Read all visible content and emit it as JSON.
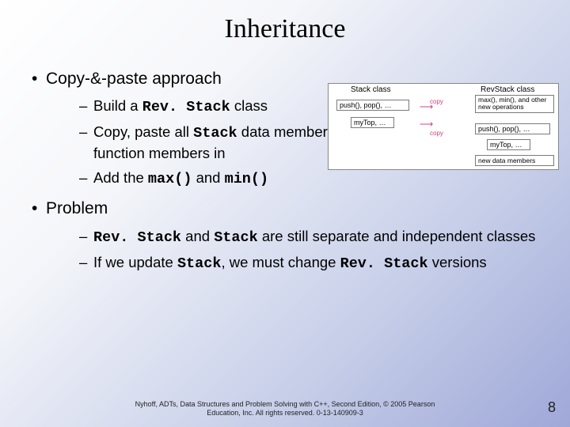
{
  "title": "Inheritance",
  "bullets": {
    "b1": "Copy-&-paste approach",
    "b1_1_a": "Build a ",
    "b1_1_code": "Rev. Stack",
    "b1_1_b": " class",
    "b1_2_a": "Copy, paste all ",
    "b1_2_code": "Stack",
    "b1_2_b": " data members and function members in",
    "b1_3_a": "Add the ",
    "b1_3_code1": "max()",
    "b1_3_mid": " and ",
    "b1_3_code2": "min()",
    "b2": "Problem",
    "b2_1_code1": "Rev. Stack",
    "b2_1_mid": " and ",
    "b2_1_code2": "Stack",
    "b2_1_b": " are still separate and independent classes",
    "b2_2_a": "If we update ",
    "b2_2_code1": "Stack",
    "b2_2_mid": ", we must change ",
    "b2_2_code2": "Rev. Stack",
    "b2_2_b": " versions"
  },
  "diagram": {
    "left_header": "Stack class",
    "right_header": "RevStack class",
    "left_box1": "push(), pop(), …",
    "left_box2": "myTop, …",
    "right_box1": "max(), min(), and other new operations",
    "right_box2": "push(), pop(), …",
    "right_box3": "myTop, …",
    "right_box4": "new data members",
    "arrow1": "copy",
    "arrow2": "copy"
  },
  "footer_line1": "Nyhoff, ADTs, Data Structures and Problem Solving with C++, Second Edition, © 2005 Pearson",
  "footer_line2": "Education, Inc. All rights reserved. 0-13-140909-3",
  "page_number": "8"
}
